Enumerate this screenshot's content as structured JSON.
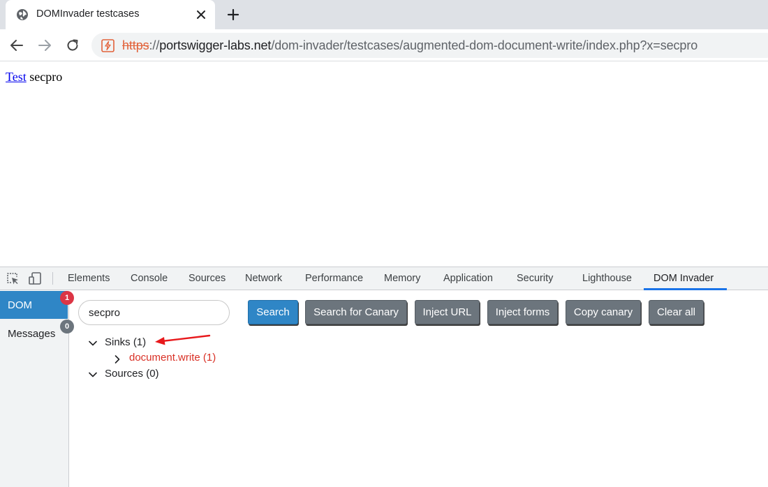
{
  "browser": {
    "tab_title": "DOMInvader testcases",
    "icons": {
      "favicon": "globe-icon",
      "close": "close-icon",
      "new_tab": "plus-icon",
      "back": "arrow-left-icon",
      "forward": "arrow-right-icon",
      "reload": "reload-icon",
      "site_info": "not-secure-icon"
    },
    "url": {
      "scheme": "https",
      "separator": "://",
      "host": "portswigger-labs.net",
      "path": "/dom-invader/testcases/augmented-dom-document-write/index.php?x=secpro"
    }
  },
  "page": {
    "link_text": "Test",
    "text": "secpro"
  },
  "devtools": {
    "tabs": [
      "Elements",
      "Console",
      "Sources",
      "Network",
      "Performance",
      "Memory",
      "Application",
      "Security",
      "Lighthouse",
      "DOM Invader"
    ],
    "active_tab": "DOM Invader",
    "icons": {
      "inspect": "inspect-element-icon",
      "device": "device-toolbar-icon"
    },
    "sidebar": {
      "items": [
        {
          "label": "DOM",
          "badge": "1",
          "badge_color": "#dc3545",
          "active": true
        },
        {
          "label": "Messages",
          "badge": "0",
          "badge_color": "#6c757d",
          "active": false
        }
      ]
    },
    "dom_invader": {
      "search_value": "secpro",
      "buttons": {
        "search": "Search",
        "search_canary": "Search for Canary",
        "inject_url": "Inject URL",
        "inject_forms": "Inject forms",
        "copy_canary": "Copy canary",
        "clear_all": "Clear all"
      },
      "tree": {
        "sinks_label": "Sinks (1)",
        "sink_item": "document.write (1)",
        "sources_label": "Sources (0)"
      }
    },
    "annotation": {
      "arrow_color": "#e8191c"
    }
  }
}
